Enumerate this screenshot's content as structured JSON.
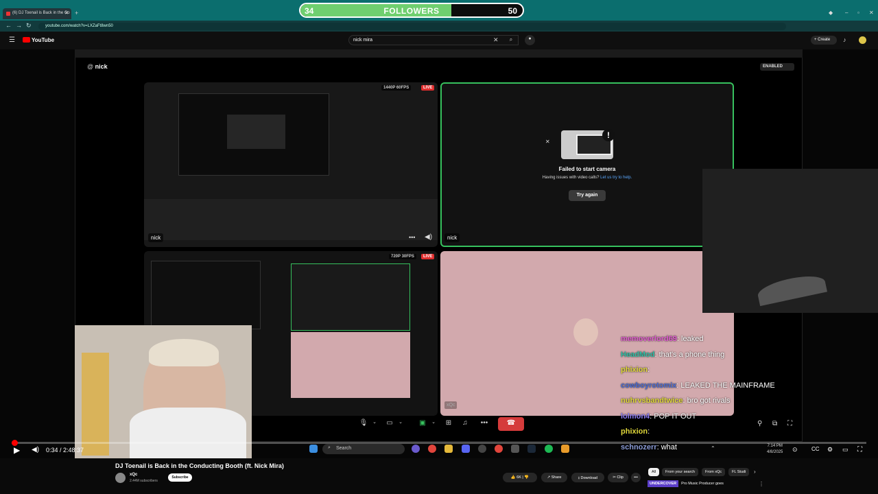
{
  "browser": {
    "tab_title": "(6) DJ Toenail is Back in the Co",
    "url": "youtube.com/watch?v=LXZaFt8wn50"
  },
  "followers_goal": {
    "current": "34",
    "label": "FOLLOWERS",
    "goal": "50",
    "progress_fraction": 0.68,
    "fill_color": "#6fcf6f"
  },
  "youtube": {
    "logo_text": "YouTube",
    "search_value": "nick mira",
    "create_label": "Create"
  },
  "discord": {
    "user_prefix": "@",
    "username": "nick",
    "enabled_badge": "ENABLED",
    "tiles": [
      {
        "resolution": "1440P 60FPS",
        "live": "LIVE",
        "name": "nick"
      },
      {
        "name": "nick",
        "error_title": "Failed to start camera",
        "error_sub": "Having issues with video calls?",
        "help_link": "Let us try to help.",
        "button": "Try again"
      },
      {
        "resolution": "720P 30FPS",
        "live": "LIVE"
      },
      {
        "tag": "xQc"
      }
    ]
  },
  "chat": [
    {
      "user": "memoverlord69",
      "color": "#e05cd0",
      "text": ": leaked"
    },
    {
      "user": "HeadMod",
      "color": "#2fbfa5",
      "text": ": that's a phone thing"
    },
    {
      "user": "phixion",
      "color": "#e0d83a",
      "text": ": "
    },
    {
      "user": "cowboyrotomix",
      "color": "#4a6bd1",
      "text": ": LEAKED THE MAINFRAME"
    },
    {
      "user": "nuhrvsbandtwice",
      "color": "#e0d83a",
      "text": ": bro got rivals"
    },
    {
      "user": "lolmon4",
      "color": "#8a7cf0",
      "text": ": POP IT OUT"
    },
    {
      "user": "phixion",
      "color": "#e0d83a",
      "text": ": "
    },
    {
      "user": "schnozerr",
      "color": "#8a9bd6",
      "text": ": what"
    }
  ],
  "player": {
    "time": "0:34 / 2:48:37",
    "progress_fraction": 0.003
  },
  "taskbar": {
    "search_placeholder": "Search",
    "time": "7:14 PM",
    "date": "4/8/2025"
  },
  "video_info": {
    "title": "DJ Toenail is Back in the Conducting Booth (ft. Nick Mira)",
    "channel": "xQc",
    "subscribers": "2.44M subscribers",
    "subscribe_label": "Subscribe",
    "likes": "6K",
    "share_label": "Share",
    "download_label": "Download",
    "clip_label": "Clip"
  },
  "chips": [
    "All",
    "From your search",
    "From xQc",
    "FL Studi"
  ],
  "recommendation": {
    "thumb_text": "UNDERCOVER",
    "title": "Pro Music Producer goes"
  }
}
